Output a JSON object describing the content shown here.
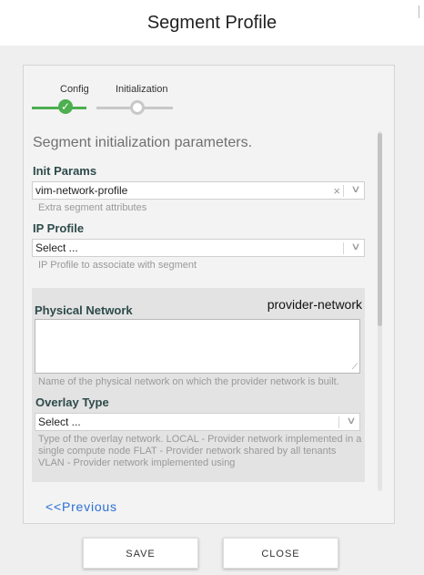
{
  "dialog": {
    "title": "Segment Profile"
  },
  "steps": [
    {
      "label": "Config",
      "state": "done"
    },
    {
      "label": "Initialization",
      "state": "pending"
    }
  ],
  "intro_text": "Segment initialization parameters.",
  "init_params": {
    "label": "Init Params",
    "value": "vim-network-profile",
    "hint": "Extra segment attributes"
  },
  "ip_profile": {
    "label": "IP Profile",
    "placeholder": "Select ...",
    "hint": "IP Profile to associate with segment"
  },
  "physical_network": {
    "label": "Physical Network",
    "value_label": "provider-network",
    "textarea_value": "",
    "hint": "Name of the physical network on which the provider network is built."
  },
  "overlay_type": {
    "label": "Overlay Type",
    "placeholder": "Select ...",
    "hint": "Type of the overlay network. LOCAL - Provider network implemented in a single compute node FLAT - Provider network shared by all tenants VLAN - Provider network implemented using"
  },
  "nav": {
    "previous_label": "<<Previous"
  },
  "buttons": {
    "save": "SAVE",
    "close": "CLOSE"
  },
  "colors": {
    "accent_green": "#4caf50",
    "link_blue": "#2a6fd6",
    "label_teal": "#2e4a4a"
  }
}
